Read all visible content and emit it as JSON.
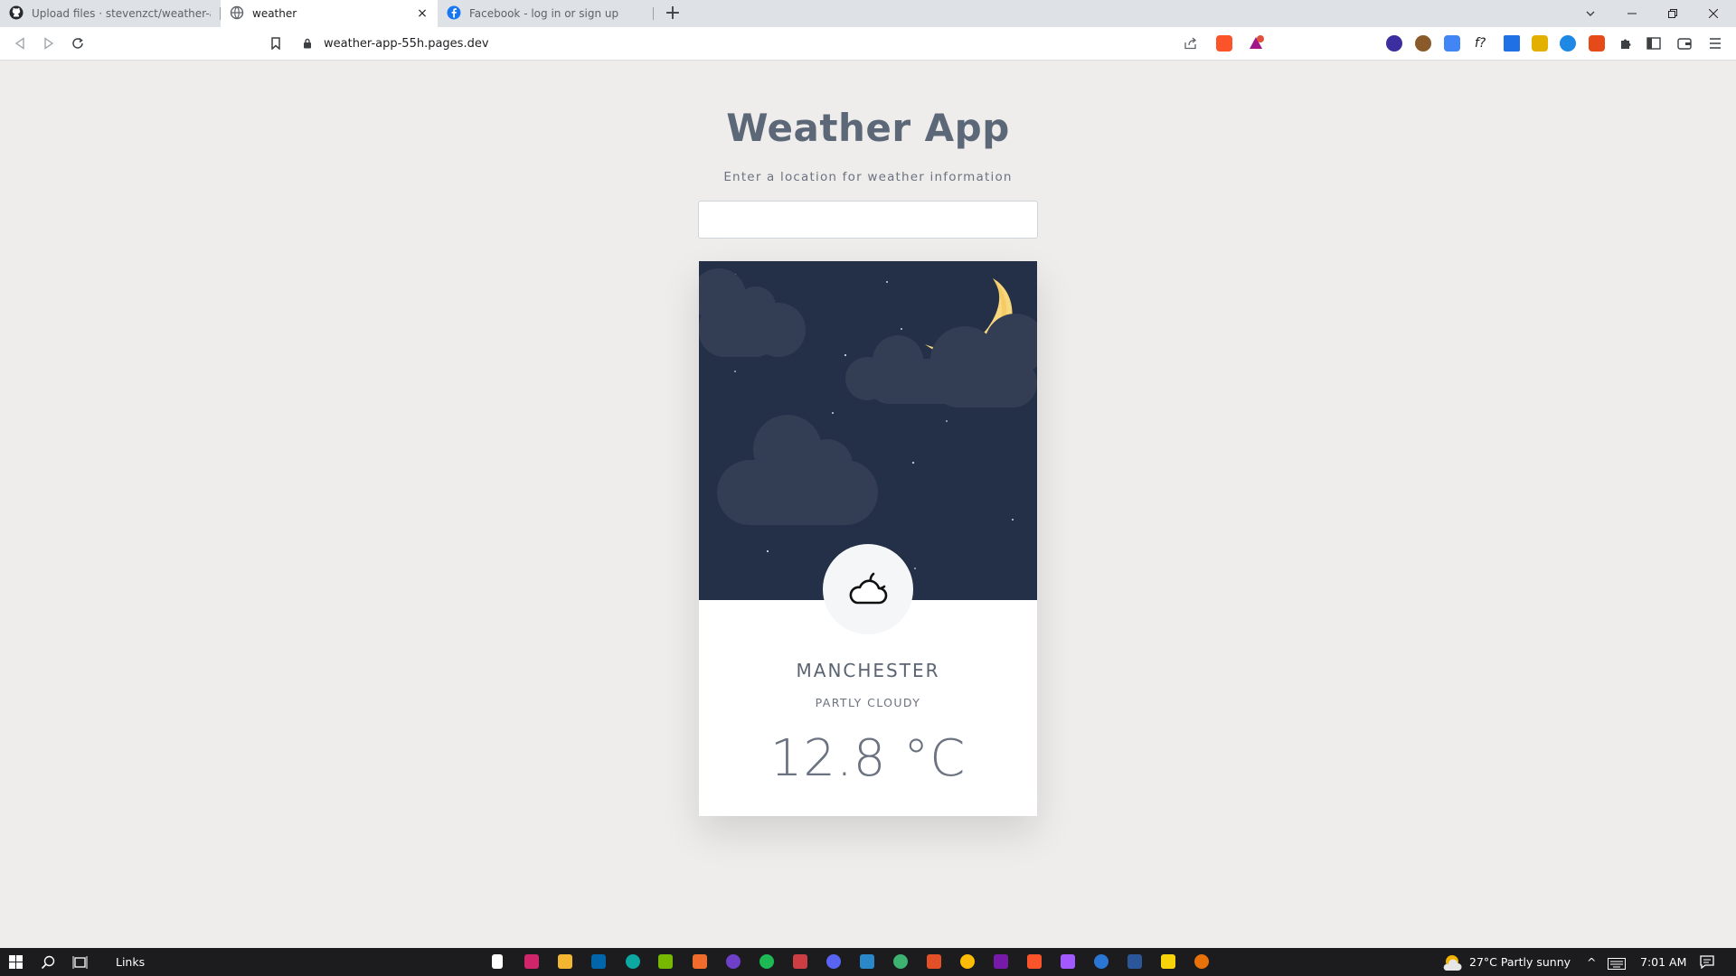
{
  "browser": {
    "tabs": [
      {
        "title": "Upload files · stevenzct/weather-app",
        "icon": "github-icon"
      },
      {
        "title": "weather",
        "icon": "globe-icon",
        "close": "×"
      },
      {
        "title": "Facebook - log in or sign up",
        "icon": "facebook-icon"
      }
    ],
    "new_tab_label": "+",
    "url": "weather-app-55h.pages.dev"
  },
  "app": {
    "title": "Weather App",
    "subtitle": "Enter a location for weather information",
    "search": {
      "value": "",
      "placeholder": ""
    }
  },
  "weather": {
    "city": "MANCHESTER",
    "condition": "PARTLY CLOUDY",
    "temperature": "12.8 °C",
    "icon": "moon-cloud-icon",
    "sky_color": "#242f48",
    "cloud_color": "#333e55",
    "moon_color": "#f8d77d"
  },
  "taskbar": {
    "links_label": "Links",
    "weather_text": "27°C  Partly sunny",
    "time": "7:01 AM"
  }
}
